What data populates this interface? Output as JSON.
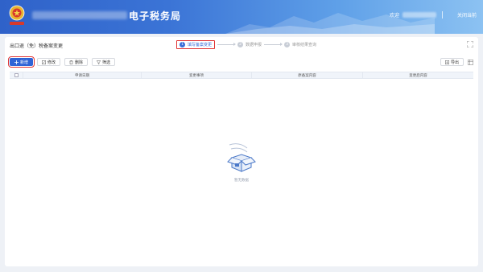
{
  "header": {
    "site_title": "电子税务局",
    "user_suffix": "欢迎",
    "close_label": "关闭当前"
  },
  "page": {
    "title": "出口退（免）税备案变更",
    "steps": [
      {
        "num": "1",
        "label": "填写备案变更"
      },
      {
        "num": "2",
        "label": "数据申报"
      },
      {
        "num": "3",
        "label": "审核结果查询"
      }
    ]
  },
  "toolbar": {
    "add_label": "新增",
    "edit_label": "修改",
    "delete_label": "删除",
    "filter_label": "筛选",
    "export_label": "导出"
  },
  "table": {
    "columns": [
      "申请日期",
      "变更事项",
      "原备案内容",
      "变更后内容"
    ]
  },
  "empty": {
    "text": "暂无数据"
  },
  "colors": {
    "primary": "#2f64d6",
    "highlight": "#e03434",
    "header_gradient_start": "#2f62c9",
    "header_gradient_end": "#8cc2f2"
  }
}
